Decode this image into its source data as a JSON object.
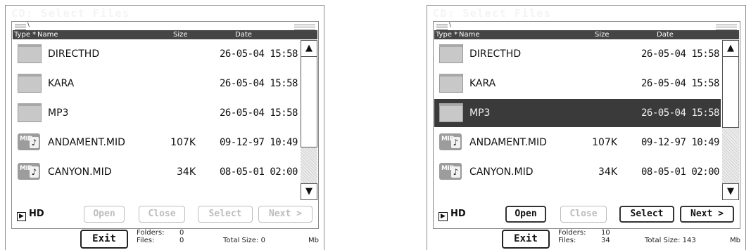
{
  "title": "CD: Select Files",
  "columns": {
    "type": "Type *",
    "name": "Name",
    "size": "Size",
    "date": "Date"
  },
  "left": {
    "rows": [
      {
        "icon": "folder-icon",
        "name": "DIRECTHD",
        "size": "",
        "date": "26-05-04 15:58"
      },
      {
        "icon": "folder-icon",
        "name": "KARA",
        "size": "",
        "date": "26-05-04 15:58"
      },
      {
        "icon": "folder-icon",
        "name": "MP3",
        "size": "",
        "date": "26-05-04 15:58"
      },
      {
        "icon": "midi-file-icon",
        "name": "ANDAMENT.MID",
        "size": "107K",
        "date": "09-12-97 10:49"
      },
      {
        "icon": "midi-file-icon",
        "name": "CANYON.MID",
        "size": "34K",
        "date": "08-05-01 02:00"
      }
    ],
    "device": "HD",
    "buttons": {
      "open": "Open",
      "close": "Close",
      "select": "Select",
      "next": "Next >",
      "exit": "Exit"
    },
    "info": {
      "folders_label": "Folders:",
      "folders": "0",
      "files_label": "Files:",
      "files": "0",
      "total": "Total Size: 0",
      "unit": "Mb"
    }
  },
  "right": {
    "rows": [
      {
        "icon": "folder-icon",
        "name": "DIRECTHD",
        "size": "",
        "date": "26-05-04 15:58"
      },
      {
        "icon": "folder-icon",
        "name": "KARA",
        "size": "",
        "date": "26-05-04 15:58"
      },
      {
        "icon": "folder-icon",
        "name": "MP3",
        "size": "",
        "date": "26-05-04 15:58",
        "selected": true
      },
      {
        "icon": "midi-file-icon",
        "name": "ANDAMENT.MID",
        "size": "107K",
        "date": "09-12-97 10:49"
      },
      {
        "icon": "midi-file-icon",
        "name": "CANYON.MID",
        "size": "34K",
        "date": "08-05-01 02:00"
      }
    ],
    "device": "HD",
    "buttons": {
      "open": "Open",
      "close": "Close",
      "select": "Select",
      "next": "Next >",
      "exit": "Exit"
    },
    "info": {
      "folders_label": "Folders:",
      "folders": "10",
      "files_label": "Files:",
      "files": "34",
      "total": "Total Size: 143",
      "unit": "Mb"
    }
  },
  "icons": {
    "midi_text": "MID",
    "note_glyph": "♪",
    "up_arrow": "▲",
    "down_arrow": "▼",
    "play_glyph": "▶"
  }
}
